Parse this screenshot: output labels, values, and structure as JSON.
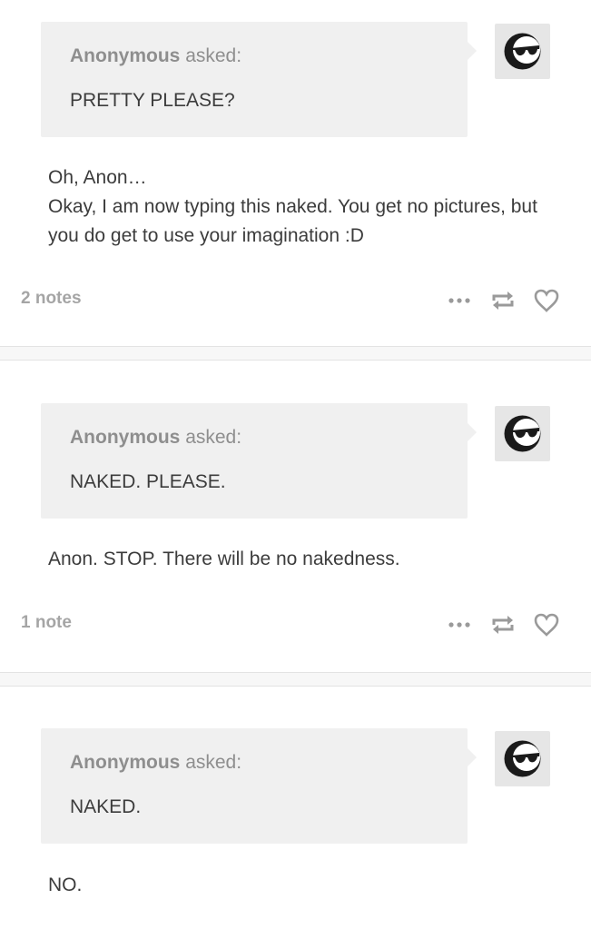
{
  "posts": [
    {
      "asker_name": "Anonymous",
      "asked_word": "asked:",
      "question": "PRETTY PLEASE?",
      "answer_lines": [
        "Oh, Anon…",
        "Okay, I am now typing this naked. You get no pictures, but you do get to use your imagination :D"
      ],
      "notes": "2 notes",
      "avatar_icon": "sunglasses-face-icon",
      "action_icons": [
        "more-dots-icon",
        "reblog-icon",
        "like-heart-icon"
      ]
    },
    {
      "asker_name": "Anonymous",
      "asked_word": "asked:",
      "question": "NAKED. PLEASE.",
      "answer_lines": [
        "Anon. STOP. There will be no nakedness."
      ],
      "notes": "1 note",
      "avatar_icon": "sunglasses-face-icon",
      "action_icons": [
        "more-dots-icon",
        "reblog-icon",
        "like-heart-icon"
      ]
    },
    {
      "asker_name": "Anonymous",
      "asked_word": "asked:",
      "question": "NAKED.",
      "answer_lines": [
        "NO."
      ],
      "avatar_icon": "sunglasses-face-icon"
    }
  ],
  "colors": {
    "bubble_bg": "#f0f0f0",
    "avatar_bg": "#e6e6e6",
    "muted_text": "#8e8e8e",
    "body_text": "#3c3c3c",
    "notes_text": "#a5a5a5",
    "icon_gray": "#9a9a9a",
    "divider_bg": "#f7f7f7"
  }
}
